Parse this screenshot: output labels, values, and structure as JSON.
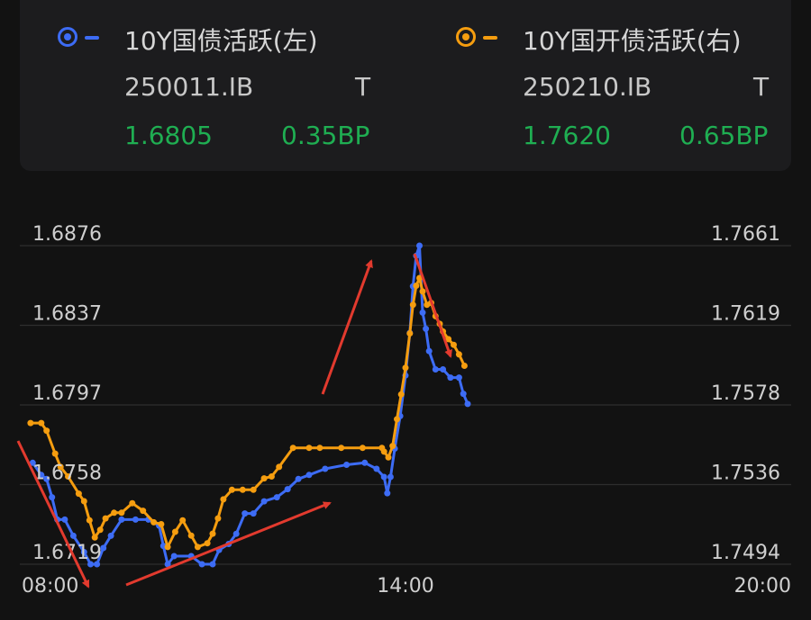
{
  "header": {
    "left": {
      "name": "10Y国债活跃(左)",
      "code": "250011.IB",
      "flag": "T",
      "price": "1.6805",
      "change": "0.35BP",
      "color": "#3d6cf5"
    },
    "right": {
      "name": "10Y国开债活跃(右)",
      "code": "250210.IB",
      "flag": "T",
      "price": "1.7620",
      "change": "0.65BP",
      "color": "#f59d0f"
    }
  },
  "colors": {
    "background": "#121212",
    "grid": "#2e2e2e",
    "up": "#1fae52",
    "arrow": "#e23a2e"
  },
  "chart_data": {
    "type": "line",
    "x_ticks": [
      "08:00",
      "14:00",
      "20:00"
    ],
    "y_left_ticks": [
      "1.6876",
      "1.6837",
      "1.6797",
      "1.6758",
      "1.6719"
    ],
    "y_right_ticks": [
      "1.7661",
      "1.7619",
      "1.7578",
      "1.7536",
      "1.7494"
    ],
    "ylim_left": [
      1.6719,
      1.6876
    ],
    "ylim_right": [
      1.7494,
      1.7661
    ],
    "xlim_hours": [
      8,
      20
    ],
    "series": [
      {
        "name": "10Y国债活跃(左)",
        "axis": "left",
        "color": "#3d6cf5",
        "points": [
          [
            "08:12",
            1.6769
          ],
          [
            "08:20",
            1.6763
          ],
          [
            "08:25",
            1.6761
          ],
          [
            "08:30",
            1.6752
          ],
          [
            "08:35",
            1.6741
          ],
          [
            "08:42",
            1.6741
          ],
          [
            "08:50",
            1.6733
          ],
          [
            "09:00",
            1.6725
          ],
          [
            "09:06",
            1.6719
          ],
          [
            "09:12",
            1.6719
          ],
          [
            "09:18",
            1.6727
          ],
          [
            "09:25",
            1.6733
          ],
          [
            "09:35",
            1.6741
          ],
          [
            "09:48",
            1.6741
          ],
          [
            "10:00",
            1.6741
          ],
          [
            "10:10",
            1.6738
          ],
          [
            "10:14",
            1.6728
          ],
          [
            "10:18",
            1.6719
          ],
          [
            "10:24",
            1.6723
          ],
          [
            "10:40",
            1.6723
          ],
          [
            "10:50",
            1.6719
          ],
          [
            "11:00",
            1.6719
          ],
          [
            "11:06",
            1.6726
          ],
          [
            "11:15",
            1.6729
          ],
          [
            "11:22",
            1.6734
          ],
          [
            "11:30",
            1.6744
          ],
          [
            "11:38",
            1.6744
          ],
          [
            "11:48",
            1.675
          ],
          [
            "12:00",
            1.6752
          ],
          [
            "12:10",
            1.6756
          ],
          [
            "12:20",
            1.6761
          ],
          [
            "12:30",
            1.6763
          ],
          [
            "12:45",
            1.6766
          ],
          [
            "13:05",
            1.6768
          ],
          [
            "13:22",
            1.6769
          ],
          [
            "13:33",
            1.6766
          ],
          [
            "13:40",
            1.6762
          ],
          [
            "13:43",
            1.6754
          ],
          [
            "13:46",
            1.6762
          ],
          [
            "13:50",
            1.6776
          ],
          [
            "13:55",
            1.6792
          ],
          [
            "14:00",
            1.6812
          ],
          [
            "14:04",
            1.6833
          ],
          [
            "14:07",
            1.6856
          ],
          [
            "14:10",
            1.6871
          ],
          [
            "14:13",
            1.6876
          ],
          [
            "14:16",
            1.6843
          ],
          [
            "14:19",
            1.6835
          ],
          [
            "14:22",
            1.6824
          ],
          [
            "14:28",
            1.6815
          ],
          [
            "14:35",
            1.6815
          ],
          [
            "14:42",
            1.6811
          ],
          [
            "14:50",
            1.6811
          ],
          [
            "14:54",
            1.6803
          ],
          [
            "14:58",
            1.6798
          ]
        ]
      },
      {
        "name": "10Y国开债活跃(右)",
        "axis": "right",
        "color": "#f59d0f",
        "points": [
          [
            "08:10",
            1.7568
          ],
          [
            "08:20",
            1.7568
          ],
          [
            "08:25",
            1.7564
          ],
          [
            "08:33",
            1.7552
          ],
          [
            "08:38",
            1.7545
          ],
          [
            "08:45",
            1.754
          ],
          [
            "08:55",
            1.7531
          ],
          [
            "09:00",
            1.7527
          ],
          [
            "09:05",
            1.7517
          ],
          [
            "09:10",
            1.7508
          ],
          [
            "09:15",
            1.7512
          ],
          [
            "09:20",
            1.7518
          ],
          [
            "09:28",
            1.7521
          ],
          [
            "09:35",
            1.7521
          ],
          [
            "09:45",
            1.7526
          ],
          [
            "09:55",
            1.7522
          ],
          [
            "10:05",
            1.7516
          ],
          [
            "10:12",
            1.7515
          ],
          [
            "10:18",
            1.7503
          ],
          [
            "10:25",
            1.7511
          ],
          [
            "10:32",
            1.7517
          ],
          [
            "10:40",
            1.7509
          ],
          [
            "10:46",
            1.7503
          ],
          [
            "10:55",
            1.7505
          ],
          [
            "11:00",
            1.751
          ],
          [
            "11:05",
            1.7518
          ],
          [
            "11:10",
            1.7528
          ],
          [
            "11:18",
            1.7533
          ],
          [
            "11:28",
            1.7533
          ],
          [
            "11:38",
            1.7533
          ],
          [
            "11:48",
            1.7539
          ],
          [
            "11:55",
            1.754
          ],
          [
            "12:02",
            1.7545
          ],
          [
            "12:15",
            1.7555
          ],
          [
            "12:30",
            1.7555
          ],
          [
            "12:40",
            1.7555
          ],
          [
            "13:00",
            1.7555
          ],
          [
            "13:20",
            1.7555
          ],
          [
            "13:38",
            1.7555
          ],
          [
            "13:40",
            1.7553
          ],
          [
            "13:44",
            1.755
          ],
          [
            "13:48",
            1.7556
          ],
          [
            "13:52",
            1.757
          ],
          [
            "13:56",
            1.7583
          ],
          [
            "14:00",
            1.7597
          ],
          [
            "14:04",
            1.7615
          ],
          [
            "14:07",
            1.763
          ],
          [
            "14:10",
            1.764
          ],
          [
            "14:13",
            1.7644
          ],
          [
            "14:16",
            1.7637
          ],
          [
            "14:20",
            1.763
          ],
          [
            "14:24",
            1.7631
          ],
          [
            "14:28",
            1.7624
          ],
          [
            "14:32",
            1.762
          ],
          [
            "14:35",
            1.7616
          ],
          [
            "14:40",
            1.7612
          ],
          [
            "14:45",
            1.7609
          ],
          [
            "14:50",
            1.7604
          ],
          [
            "14:55",
            1.7598
          ]
        ]
      }
    ]
  }
}
